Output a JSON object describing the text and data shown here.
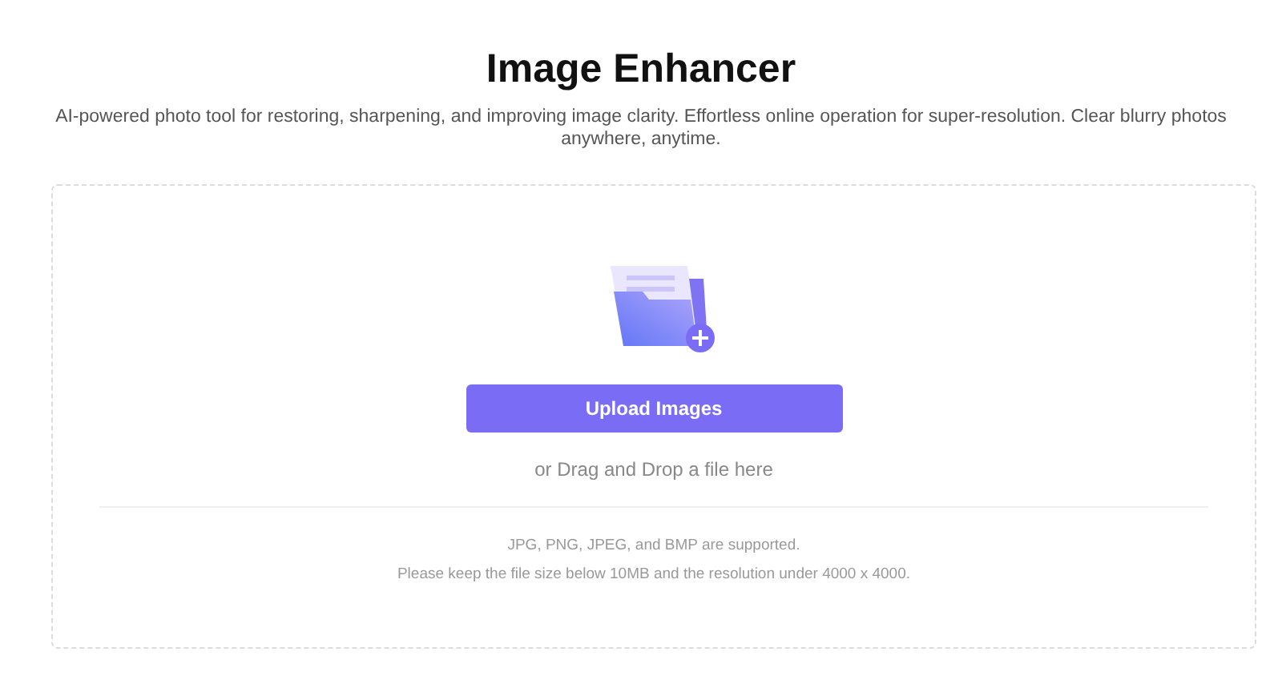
{
  "title": "Image Enhancer",
  "description": "AI-powered photo tool for restoring, sharpening, and improving image clarity. Effortless online operation for super-resolution. Clear blurry photos anywhere, anytime.",
  "upload": {
    "button": "Upload Images",
    "hint": "or Drag and Drop a file here",
    "notes": [
      "JPG, PNG, JPEG, and BMP are supported.",
      "Please keep the file size below 10MB and the resolution under 4000 x 4000."
    ]
  }
}
